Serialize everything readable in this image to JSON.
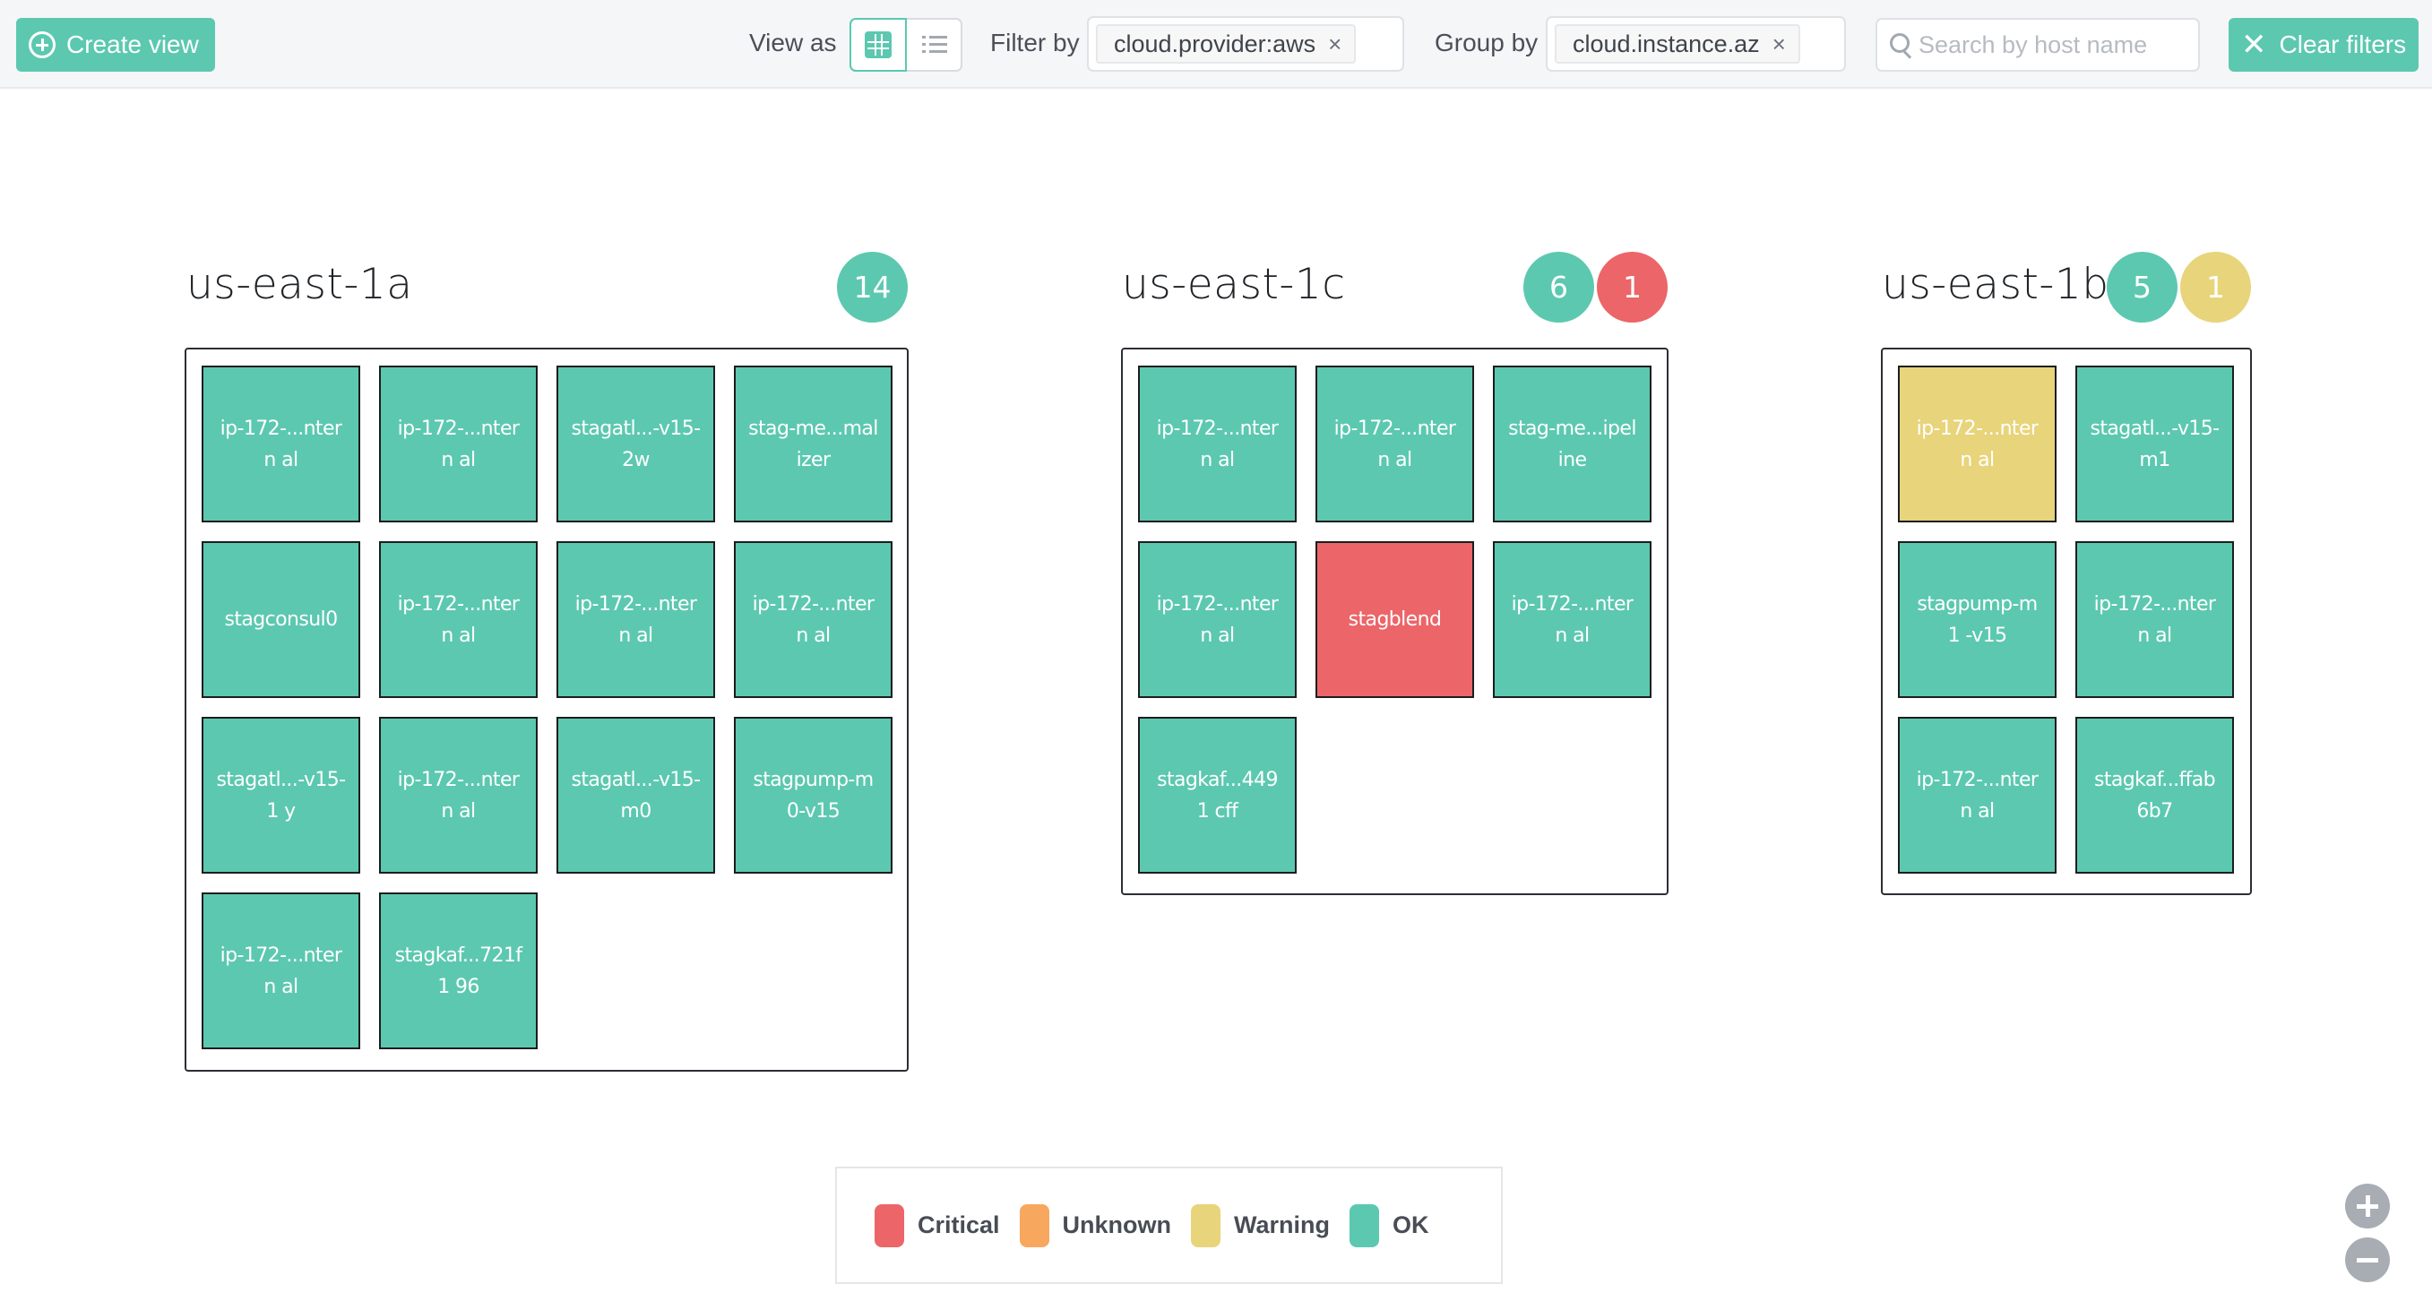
{
  "header": {
    "create_view_label": "Create view",
    "view_as_label": "View as",
    "view_modes": [
      {
        "name": "grid",
        "icon": "grid-icon",
        "active": true
      },
      {
        "name": "list",
        "icon": "list-icon",
        "active": false
      }
    ],
    "filter_by_label": "Filter by",
    "filter_tags": [
      "cloud.provider:aws"
    ],
    "group_by_label": "Group by",
    "group_tags": [
      "cloud.instance.az"
    ],
    "search_placeholder": "Search by host name",
    "search_value": "",
    "clear_filters_label": "Clear filters",
    "tag_remove_glyph": "×",
    "clear_glyph": "✕"
  },
  "colors": {
    "critical": "#ec6568",
    "unknown": "#f7a75e",
    "warning": "#e8d47a",
    "ok": "#5cc8b0"
  },
  "groups": [
    {
      "name": "us-east-1a",
      "columns": 4,
      "counts": [
        {
          "status": "ok",
          "value": "14"
        }
      ],
      "hosts": [
        {
          "label": "ip-172-...ntern al",
          "status": "ok"
        },
        {
          "label": "ip-172-...ntern al",
          "status": "ok"
        },
        {
          "label": "stagatl...-v15- 2w",
          "status": "ok"
        },
        {
          "label": "stag-me...mal izer",
          "status": "ok"
        },
        {
          "label": "stagconsul0",
          "status": "ok"
        },
        {
          "label": "ip-172-...ntern al",
          "status": "ok"
        },
        {
          "label": "ip-172-...ntern al",
          "status": "ok"
        },
        {
          "label": "ip-172-...ntern al",
          "status": "ok"
        },
        {
          "label": "stagatl...-v15-1 y",
          "status": "ok"
        },
        {
          "label": "ip-172-...ntern al",
          "status": "ok"
        },
        {
          "label": "stagatl...-v15- m0",
          "status": "ok"
        },
        {
          "label": "stagpump-m 0-v15",
          "status": "ok"
        },
        {
          "label": "ip-172-...ntern al",
          "status": "ok"
        },
        {
          "label": "stagkaf...721f1 96",
          "status": "ok"
        }
      ]
    },
    {
      "name": "us-east-1c",
      "columns": 3,
      "counts": [
        {
          "status": "ok",
          "value": "6"
        },
        {
          "status": "critical",
          "value": "1"
        }
      ],
      "hosts": [
        {
          "label": "ip-172-...ntern al",
          "status": "ok"
        },
        {
          "label": "ip-172-...ntern al",
          "status": "ok"
        },
        {
          "label": "stag-me...ipel ine",
          "status": "ok"
        },
        {
          "label": "ip-172-...ntern al",
          "status": "ok"
        },
        {
          "label": "stagblend",
          "status": "critical"
        },
        {
          "label": "ip-172-...ntern al",
          "status": "ok"
        },
        {
          "label": "stagkaf...4491 cff",
          "status": "ok"
        }
      ]
    },
    {
      "name": "us-east-1b",
      "columns": 2,
      "counts": [
        {
          "status": "ok",
          "value": "5"
        },
        {
          "status": "warning",
          "value": "1"
        }
      ],
      "hosts": [
        {
          "label": "ip-172-...ntern al",
          "status": "warning"
        },
        {
          "label": "stagatl...-v15- m1",
          "status": "ok"
        },
        {
          "label": "stagpump-m1 -v15",
          "status": "ok"
        },
        {
          "label": "ip-172-...ntern al",
          "status": "ok"
        },
        {
          "label": "ip-172-...ntern al",
          "status": "ok"
        },
        {
          "label": "stagkaf...ffab 6b7",
          "status": "ok"
        }
      ]
    }
  ],
  "legend": [
    {
      "status": "critical",
      "label": "Critical"
    },
    {
      "status": "unknown",
      "label": "Unknown"
    },
    {
      "status": "warning",
      "label": "Warning"
    },
    {
      "status": "ok",
      "label": "OK"
    }
  ],
  "zoom_controls": {
    "zoom_in": "zoom-in",
    "zoom_out": "zoom-out"
  }
}
